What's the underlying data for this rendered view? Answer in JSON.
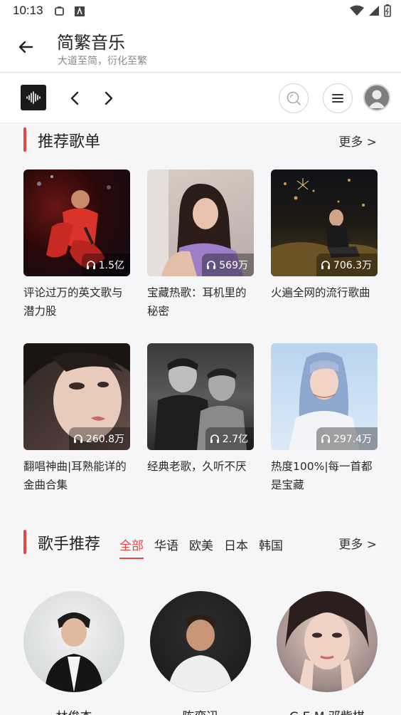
{
  "status": {
    "time": "10:13"
  },
  "appbar": {
    "title": "简繁音乐",
    "subtitle": "大道至简，衍化至繁"
  },
  "toolbar": {
    "logo_icon": "sound-wave-icon",
    "prev_icon": "chevron-left-icon",
    "next_icon": "chevron-right-icon",
    "search_icon": "search-icon",
    "menu_icon": "menu-icon",
    "avatar_icon": "user-avatar-icon"
  },
  "playlists": {
    "title": "推荐歌单",
    "more": "更多 >",
    "items": [
      {
        "title": "评论过万的英文歌与潜力股",
        "count": "1.5亿"
      },
      {
        "title": "宝藏热歌：耳机里的秘密",
        "count": "569万"
      },
      {
        "title": "火遍全网的流行歌曲",
        "count": "706.3万"
      },
      {
        "title": "翻唱神曲|耳熟能详的金曲合集",
        "count": "260.8万"
      },
      {
        "title": "经典老歌，久听不厌",
        "count": "2.7亿"
      },
      {
        "title": "热度100%|每一首都是宝藏",
        "count": "297.4万"
      }
    ]
  },
  "singers": {
    "title": "歌手推荐",
    "more": "更多 >",
    "tabs": [
      "全部",
      "华语",
      "欧美",
      "日本",
      "韩国"
    ],
    "active_tab": "全部",
    "items": [
      {
        "name": "林俊杰"
      },
      {
        "name": "陈奕迅"
      },
      {
        "name": "G.E.M.邓紫棋"
      }
    ]
  },
  "colors": {
    "accent": "#e04848",
    "background": "#f6f6f8"
  }
}
